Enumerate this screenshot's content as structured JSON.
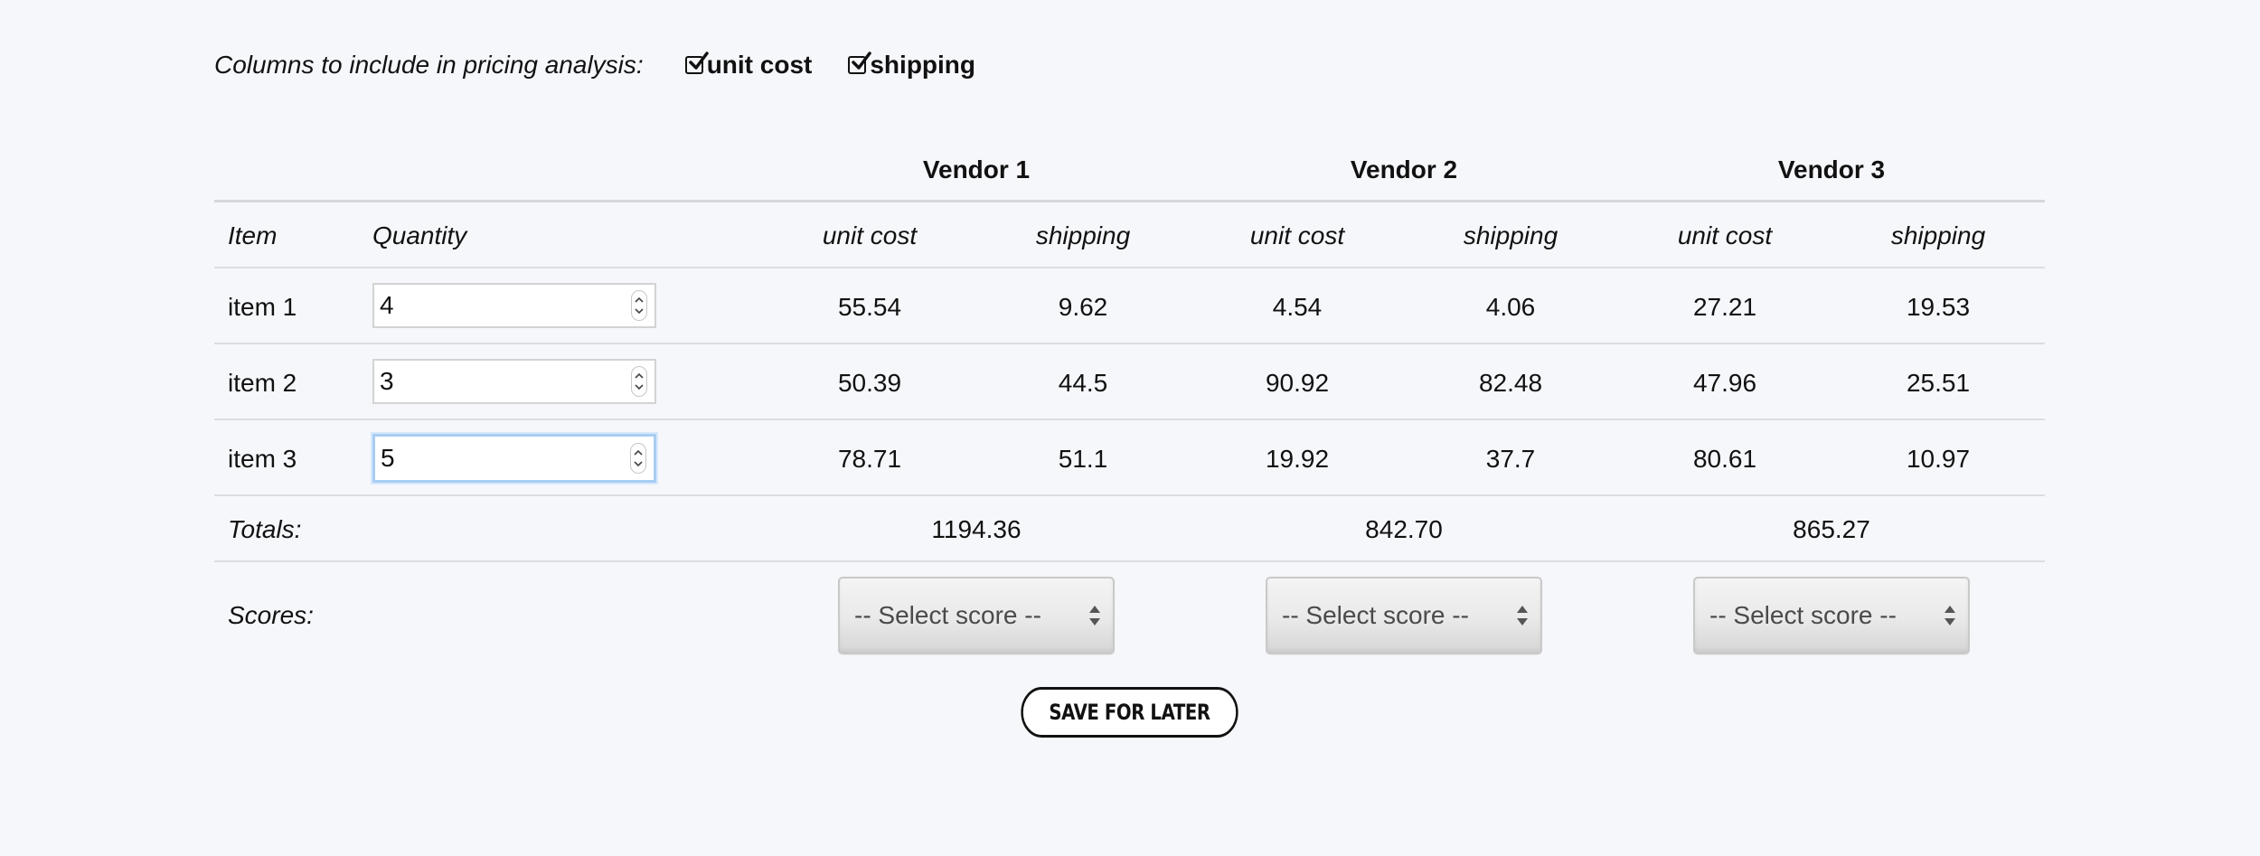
{
  "filter": {
    "label": "Columns to include in pricing analysis:",
    "options": [
      {
        "label": "unit cost",
        "checked": true
      },
      {
        "label": "shipping",
        "checked": true
      }
    ]
  },
  "table": {
    "vendors": [
      "Vendor 1",
      "Vendor 2",
      "Vendor 3"
    ],
    "columns": {
      "item": "Item",
      "quantity": "Quantity",
      "unit_cost": "unit cost",
      "shipping": "shipping"
    },
    "rows": [
      {
        "item": "item 1",
        "quantity": "4",
        "values": [
          "55.54",
          "9.62",
          "4.54",
          "4.06",
          "27.21",
          "19.53"
        ]
      },
      {
        "item": "item 2",
        "quantity": "3",
        "values": [
          "50.39",
          "44.5",
          "90.92",
          "82.48",
          "47.96",
          "25.51"
        ]
      },
      {
        "item": "item 3",
        "quantity": "5",
        "values": [
          "78.71",
          "51.1",
          "19.92",
          "37.7",
          "80.61",
          "10.97"
        ]
      }
    ],
    "totals_label": "Totals:",
    "totals": [
      "1194.36",
      "842.70",
      "865.27"
    ],
    "scores_label": "Scores:",
    "score_placeholder": "-- Select score --"
  },
  "save_button_label": "SAVE FOR LATER",
  "colors": {
    "background": "#f6f7fb",
    "focus_ring": "#a9cdf2",
    "divider": "#dcdde3"
  }
}
